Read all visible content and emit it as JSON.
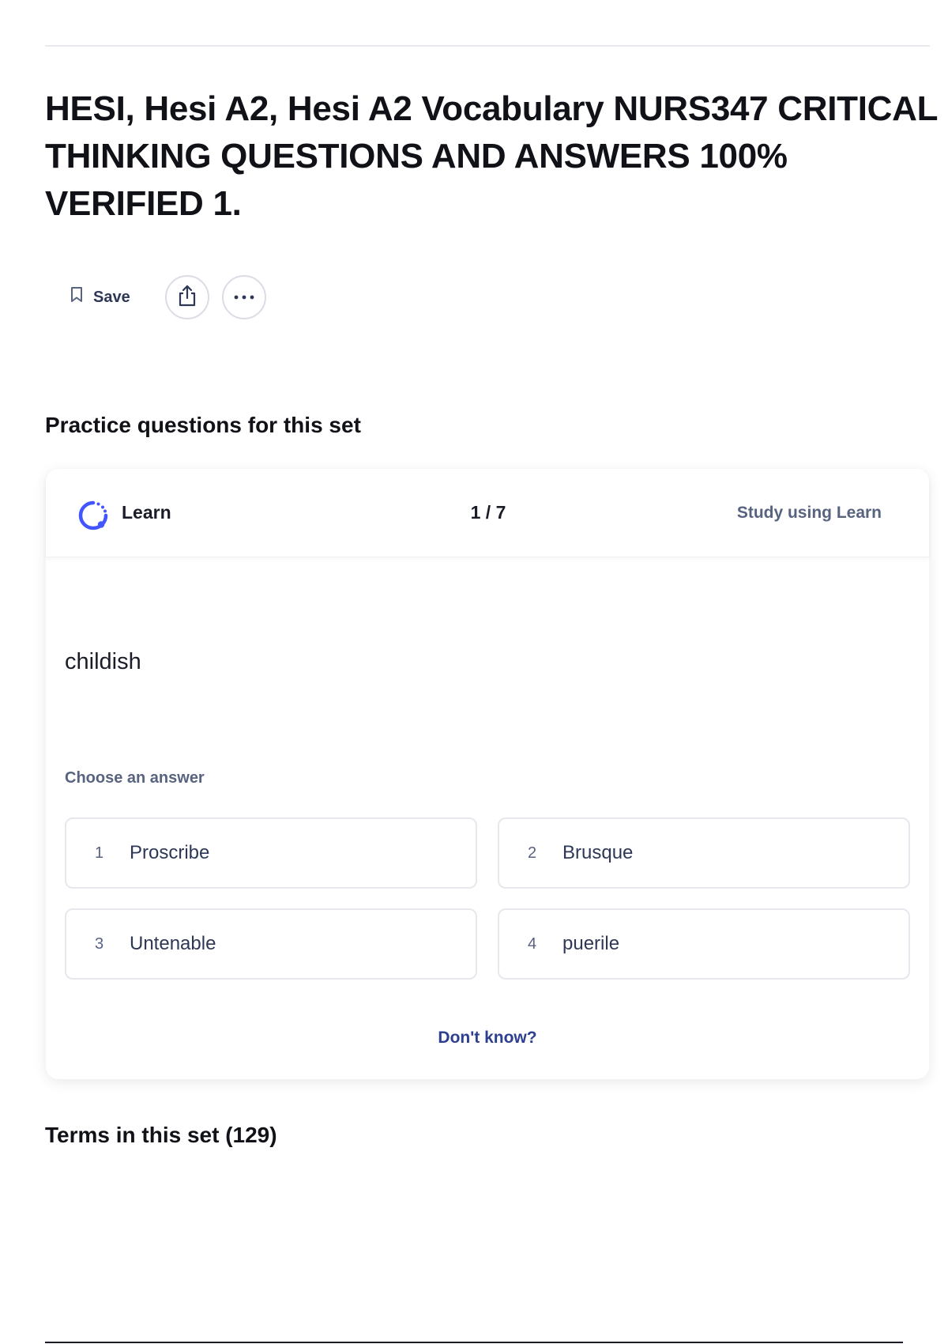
{
  "set": {
    "title": "HESI, Hesi A2, Hesi A2 Vocabulary NURS347 CRITICAL THINKING QUESTIONS AND ANSWERS 100% VERIFIED 1."
  },
  "actions": {
    "save_label": "Save",
    "icons": [
      "bookmark-icon",
      "share-icon",
      "more-icon"
    ]
  },
  "practice": {
    "heading": "Practice questions for this set",
    "mode_label": "Learn",
    "progress": "1 / 7",
    "study_link": "Study using Learn",
    "term": "childish",
    "prompt": "Choose an answer",
    "options": [
      {
        "number": "1",
        "label": "Proscribe"
      },
      {
        "number": "2",
        "label": "Brusque"
      },
      {
        "number": "3",
        "label": "Untenable"
      },
      {
        "number": "4",
        "label": "puerile"
      }
    ],
    "dont_know": "Don't know?"
  },
  "terms": {
    "heading": "Terms in this set (129)"
  },
  "colors": {
    "accent": "#4255ff",
    "link": "#2d3f8f",
    "muted_text": "#586380",
    "border": "#e6e8ee"
  }
}
